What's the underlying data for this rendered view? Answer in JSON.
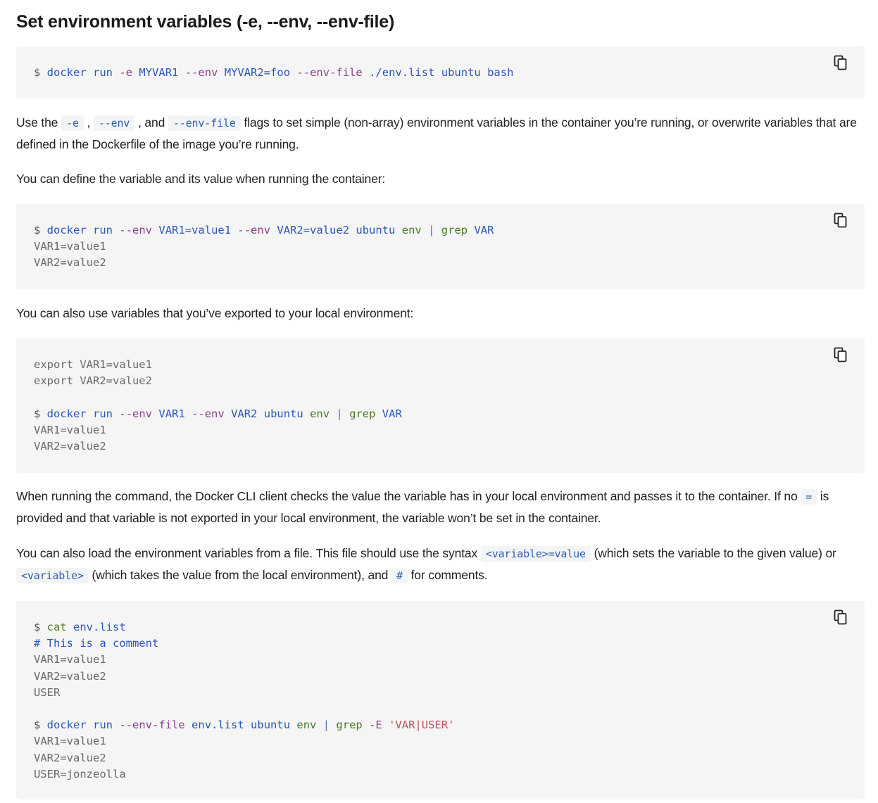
{
  "section_title": "Set environment variables (-e, --env, --env-file)",
  "code1": {
    "prompt": "$ ",
    "docker": "docker",
    "run": "run",
    "e_flag": "-e",
    "myvar1": "MYVAR1",
    "env_flag": "--env",
    "myvar2": "MYVAR2=foo",
    "envfile_flag": "--env-file",
    "envfile_path": "./env.list",
    "ubuntu": "ubuntu",
    "bash": "bash"
  },
  "para1": {
    "t1": "Use the ",
    "c1": "-e",
    "t2": " , ",
    "c2": "--env",
    "t3": " , and ",
    "c3": "--env-file",
    "t4": " flags to set simple (non-array) environment variables in the container you’re running, or overwrite variables that are defined in the Dockerfile of the image you’re running."
  },
  "para2": "You can define the variable and its value when running the container:",
  "code2": {
    "prompt": "$ ",
    "docker": "docker",
    "run": "run",
    "env1": "--env",
    "var1": "VAR1=value1",
    "env2": "--env",
    "var2": "VAR2=value2",
    "ubuntu": "ubuntu",
    "envcmd": "env",
    "pipe": "|",
    "grep": "grep",
    "var": "VAR",
    "out1": "VAR1=value1",
    "out2": "VAR2=value2"
  },
  "para3": "You can also use variables that you’ve exported to your local environment:",
  "code3": {
    "export1": "export VAR1=value1",
    "export2": "export VAR2=value2",
    "prompt": "$ ",
    "docker": "docker",
    "run": "run",
    "env1": "--env",
    "var1": "VAR1",
    "env2": "--env",
    "var2": "VAR2",
    "ubuntu": "ubuntu",
    "envcmd": "env",
    "pipe": "|",
    "grep": "grep",
    "var": "VAR",
    "out1": "VAR1=value1",
    "out2": "VAR2=value2"
  },
  "para4": {
    "t1": "When running the command, the Docker CLI client checks the value the variable has in your local environment and passes it to the container. If no ",
    "c1": "=",
    "t2": " is provided and that variable is not exported in your local environment, the variable won’t be set in the container."
  },
  "para5": {
    "t1": "You can also load the environment variables from a file. This file should use the syntax ",
    "c1": "<variable>=value",
    "t2": " (which sets the variable to the given value) or ",
    "c2": "<variable>",
    "t3": " (which takes the value from the local environment), and ",
    "c3": "#",
    "t4": " for comments."
  },
  "code4": {
    "prompt": "$ ",
    "cat": "cat",
    "envlist": "env.list",
    "comment": "# This is a comment",
    "l1": "VAR1=value1",
    "l2": "VAR2=value2",
    "l3": "USER",
    "prompt2": "$ ",
    "docker": "docker",
    "run": "run",
    "envfile": "--env-file",
    "envlist2": "env.list",
    "ubuntu": "ubuntu",
    "envcmd": "env",
    "pipe": "|",
    "grep": "grep",
    "eflag": "-E",
    "pattern": "'VAR|USER'",
    "o1": "VAR1=value1",
    "o2": "VAR2=value2",
    "o3": "USER=jonzeolla"
  },
  "icons": {
    "copy": "copy-icon"
  },
  "colors": {
    "code_bg": "#f5f5f5",
    "command": "#2b57b8",
    "flag": "#8a3f8a",
    "string": "#c0505a",
    "env": "#4a7a2a"
  }
}
